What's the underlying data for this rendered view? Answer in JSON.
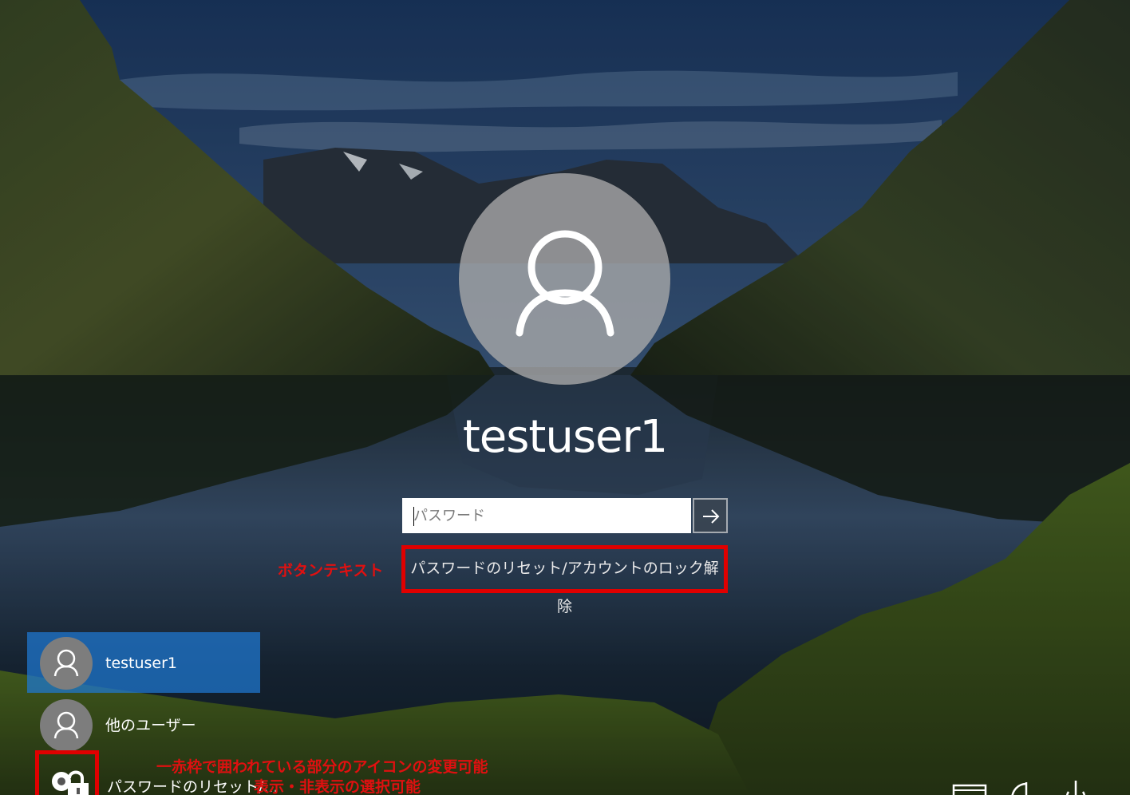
{
  "login": {
    "username": "testuser1",
    "password_placeholder": "パスワード",
    "password_value": "",
    "reset_link": "パスワードのリセット/アカウントのロック解除"
  },
  "annotations": {
    "button_text": "ボタンテキスト",
    "icon_change": "一赤枠で囲われている部分のアイコンの変更可能",
    "show_hide": "表示・非表示の選択可能"
  },
  "user_list": [
    {
      "label": "testuser1",
      "selected": true
    },
    {
      "label": "他のユーザー",
      "selected": false
    },
    {
      "label": "パスワードのリセット/..."
    }
  ],
  "colors": {
    "selected_tile": "#1e78d2",
    "annotation_red": "#e00000"
  },
  "icons": {
    "avatar": "user-icon",
    "submit": "arrow-right-icon",
    "reset": "key-lock-icon",
    "network": "network-icon",
    "ease_of_access": "ease-of-access-icon",
    "power": "power-icon"
  }
}
